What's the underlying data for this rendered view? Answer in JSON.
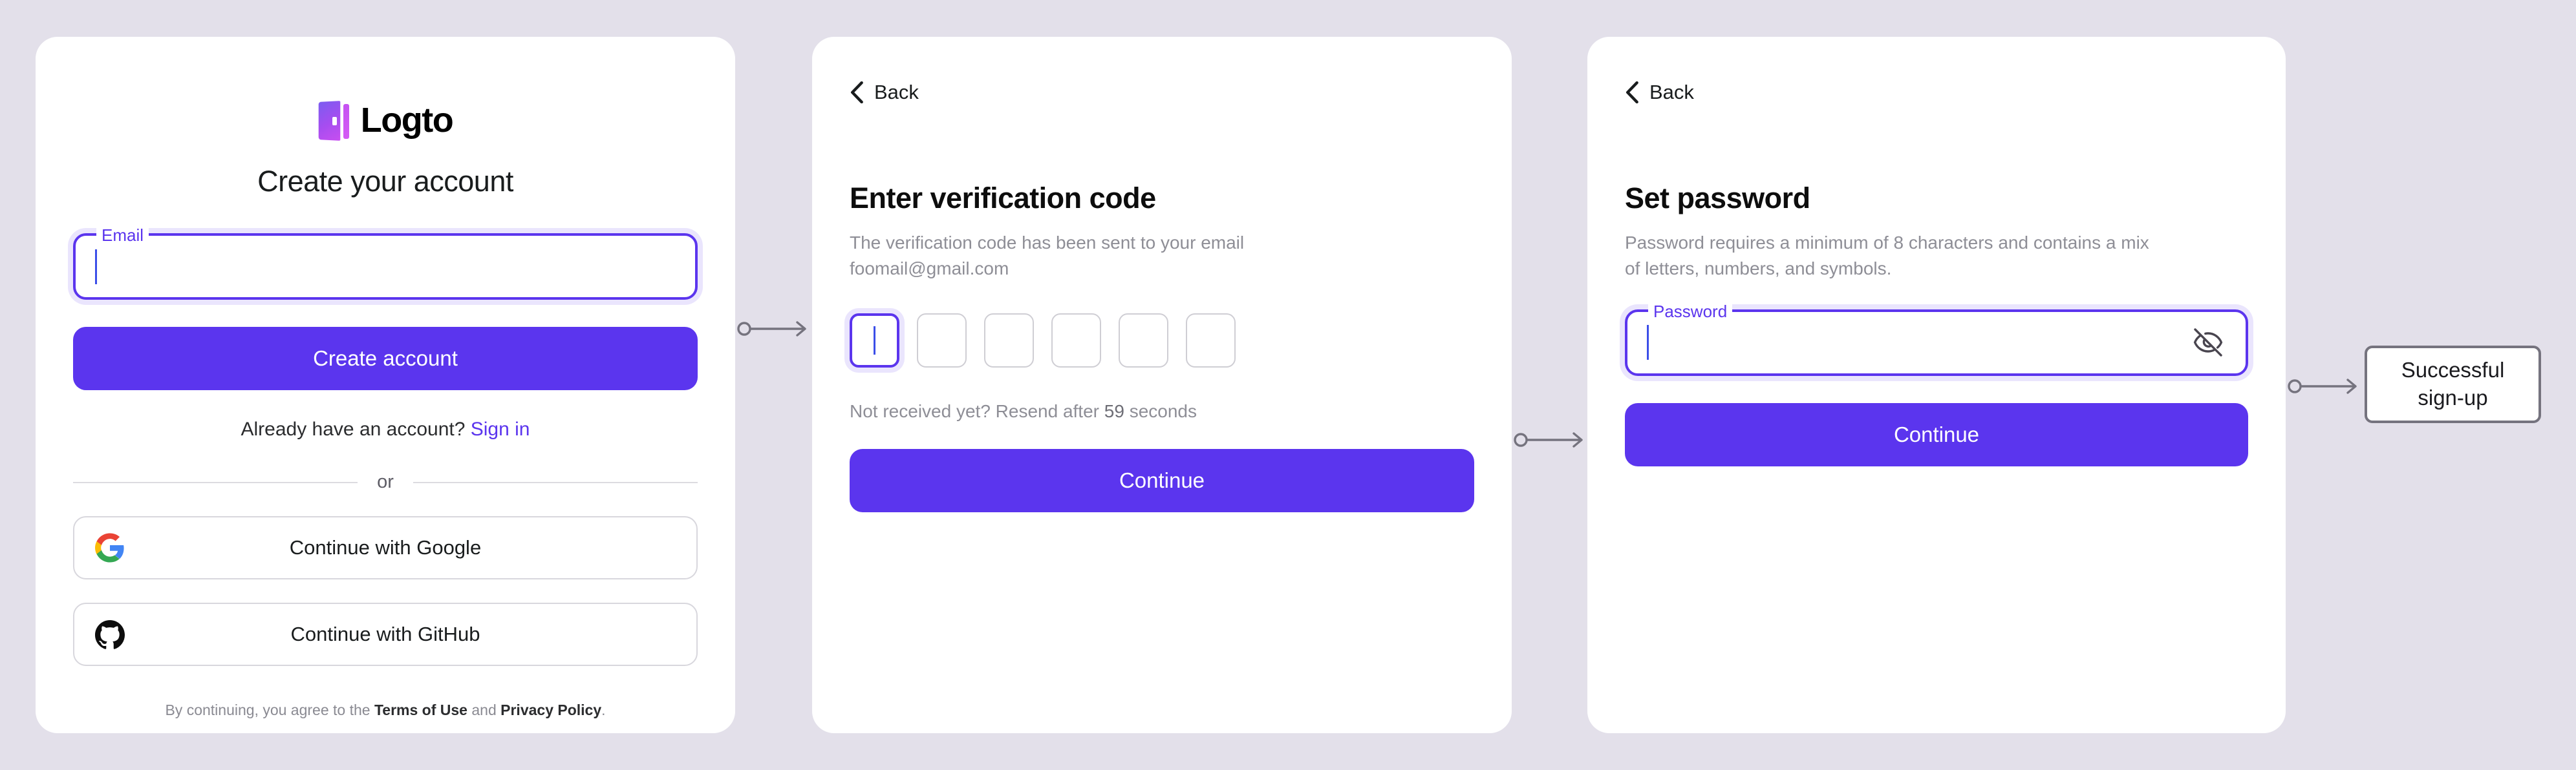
{
  "theme": {
    "background": "#e3e0ea",
    "card_background": "#ffffff",
    "accent": "#5b35ee",
    "muted_text": "#8e8e96",
    "connector": "#75737e"
  },
  "signup_card": {
    "brand": "Logto",
    "title": "Create your account",
    "email_field": {
      "label": "Email",
      "value": "",
      "placeholder": ""
    },
    "create_account_label": "Create account",
    "have_account_text": "Already have an account?",
    "sign_in_label": "Sign in",
    "divider_label": "or",
    "social_buttons": [
      {
        "icon": "google-icon",
        "label": "Continue with Google"
      },
      {
        "icon": "github-icon",
        "label": "Continue with GitHub"
      }
    ],
    "terms": {
      "prefix": "By continuing, you agree to the ",
      "terms_link": "Terms of Use",
      "middle": " and ",
      "privacy_link": "Privacy Policy",
      "suffix": "."
    }
  },
  "verification_card": {
    "back_label": "Back",
    "title": "Enter verification code",
    "description": "The verification code has been sent to your email foomail@gmail.com",
    "email": "foomail@gmail.com",
    "code_boxes": [
      "",
      "",
      "",
      "",
      "",
      ""
    ],
    "focused_box_index": 0,
    "resend": {
      "prefix": "Not received yet? Resend after ",
      "seconds": "59",
      "suffix": " seconds"
    },
    "continue_label": "Continue"
  },
  "password_card": {
    "back_label": "Back",
    "title": "Set password",
    "description": "Password requires a minimum of 8 characters and contains a mix of letters, numbers, and symbols.",
    "password_field": {
      "label": "Password",
      "value": "",
      "placeholder": ""
    },
    "toggle_visibility_icon": "eye-off-icon",
    "continue_label": "Continue"
  },
  "terminal_node": {
    "label": "Successful\nsign-up"
  }
}
